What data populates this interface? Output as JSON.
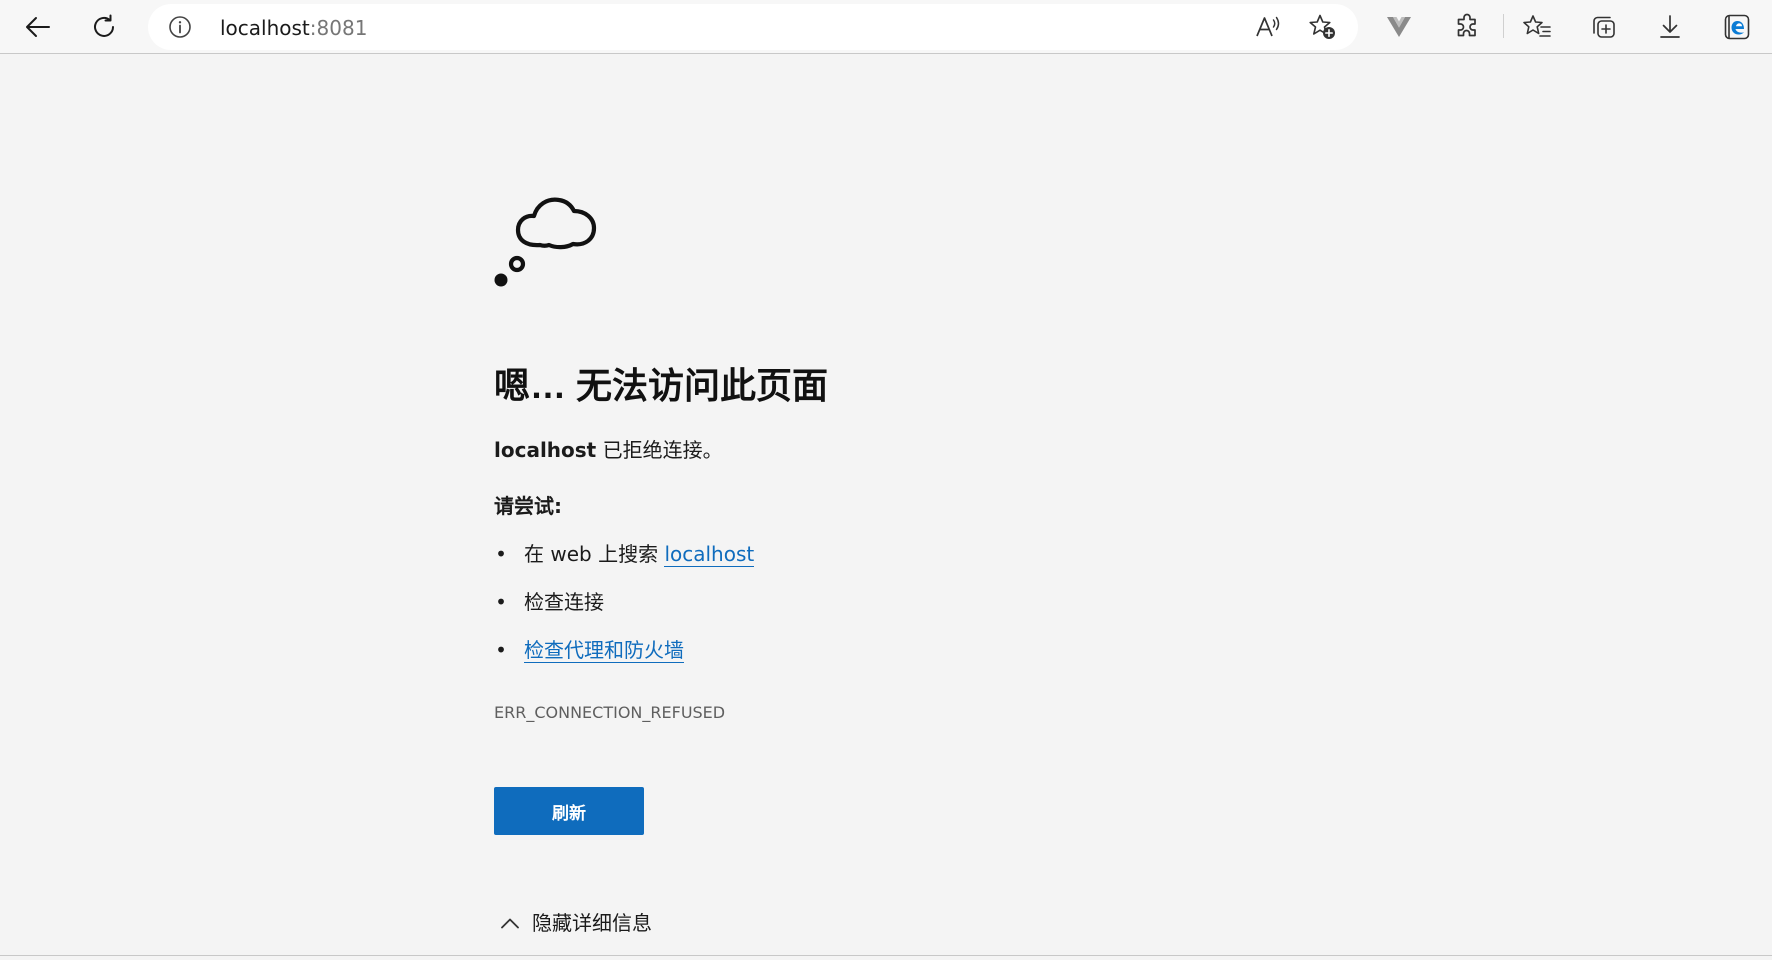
{
  "browser": {
    "address_host": "localhost",
    "address_port": ":8081",
    "icons": {
      "back": "arrow-left-icon",
      "refresh": "refresh-icon",
      "site_info": "info-icon",
      "read_aloud": "read-aloud-icon",
      "add_favorite": "star-add-icon",
      "vue_devtools": "vue-icon",
      "extensions": "puzzle-icon",
      "favorites": "favorites-icon",
      "collections": "collections-icon",
      "downloads": "download-icon",
      "edge": "edge-icon"
    }
  },
  "error_page": {
    "title": "嗯… 无法访问此页面",
    "host": "localhost",
    "message": " 已拒绝连接。",
    "try_heading": "请尝试:",
    "suggestions": {
      "search_prefix": "在 web 上搜索 ",
      "search_link": "localhost",
      "check_connection": "检查连接",
      "check_proxy": "检查代理和防火墙"
    },
    "bullet": "•",
    "error_code": "ERR_CONNECTION_REFUSED",
    "refresh_button": "刷新",
    "hide_details": "隐藏详细信息"
  },
  "colors": {
    "page_background": "#f4f4f4",
    "accent_blue": "#0f6cbd",
    "vue_icon_gray": "#8a8a8a",
    "edge_blue": "#0c7cd5"
  }
}
